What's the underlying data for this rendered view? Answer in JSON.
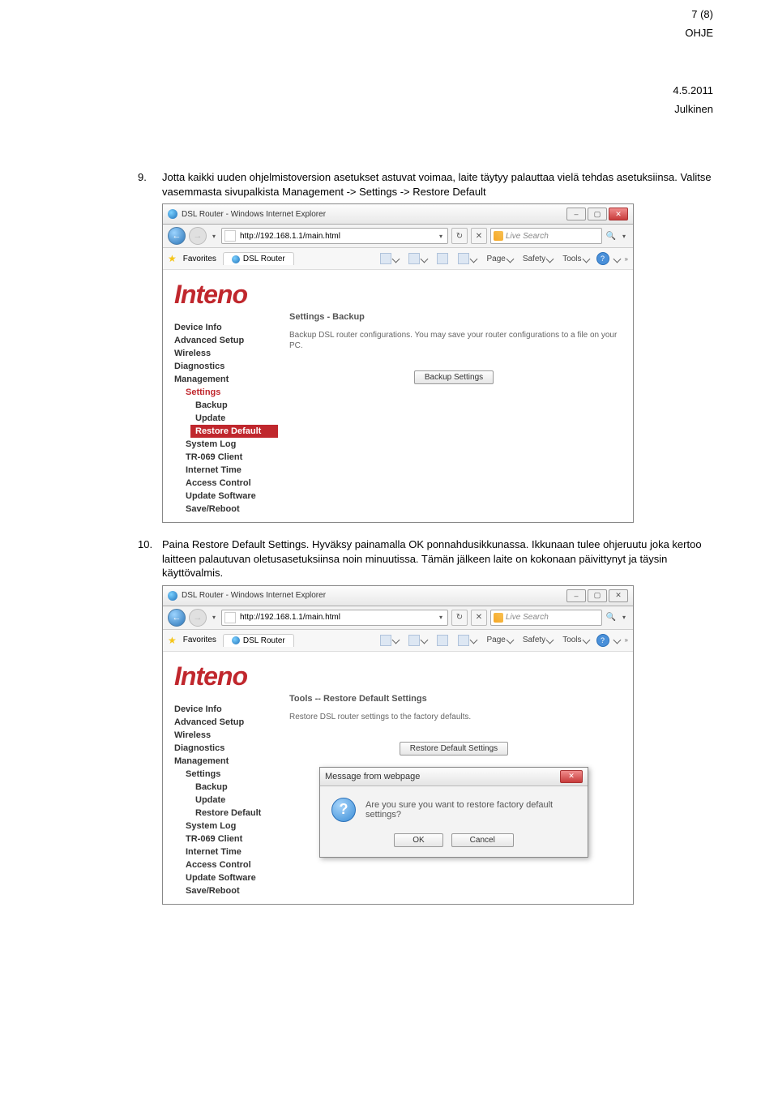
{
  "header": {
    "page_num": "7 (8)",
    "title": "OHJE",
    "date": "4.5.2011",
    "visibility": "Julkinen"
  },
  "step9": {
    "num": "9.",
    "text": "Jotta kaikki uuden ohjelmistoversion asetukset astuvat voimaa, laite täytyy palauttaa vielä tehdas asetuksiinsa. Valitse vasemmasta sivupalkista Management -> Settings -> Restore Default"
  },
  "step10": {
    "num": "10.",
    "text": "Paina Restore Default Settings. Hyväksy painamalla OK ponnahdusikkunassa. Ikkunaan tulee ohjeruutu joka kertoo laitteen palautuvan oletusasetuksiinsa noin minuutissa. Tämän jälkeen laite on kokonaan päivittynyt ja täysin käyttövalmis."
  },
  "browser": {
    "window_title": "DSL Router - Windows Internet Explorer",
    "url": "http://192.168.1.1/main.html",
    "search_placeholder": "Live Search",
    "favorites": "Favorites",
    "tab_title": "DSL Router",
    "toolbar": {
      "page": "Page",
      "safety": "Safety",
      "tools": "Tools"
    }
  },
  "router": {
    "logo": "Inteno",
    "menu": {
      "device_info": "Device Info",
      "advanced": "Advanced Setup",
      "wireless": "Wireless",
      "diagnostics": "Diagnostics",
      "management": "Management",
      "settings": "Settings",
      "backup": "Backup",
      "update": "Update",
      "restore_default": "Restore Default",
      "system_log": "System Log",
      "tr069": "TR-069 Client",
      "internet_time": "Internet Time",
      "access_control": "Access Control",
      "update_software": "Update Software",
      "save_reboot": "Save/Reboot"
    },
    "backup_page": {
      "heading": "Settings - Backup",
      "desc": "Backup DSL router configurations. You may save your router configurations to a file on your PC.",
      "button": "Backup Settings"
    },
    "restore_page": {
      "heading": "Tools -- Restore Default Settings",
      "desc": "Restore DSL router settings to the factory defaults.",
      "button": "Restore Default Settings"
    }
  },
  "dialog": {
    "title": "Message from webpage",
    "text": "Are you sure you want to restore factory default settings?",
    "ok": "OK",
    "cancel": "Cancel"
  }
}
